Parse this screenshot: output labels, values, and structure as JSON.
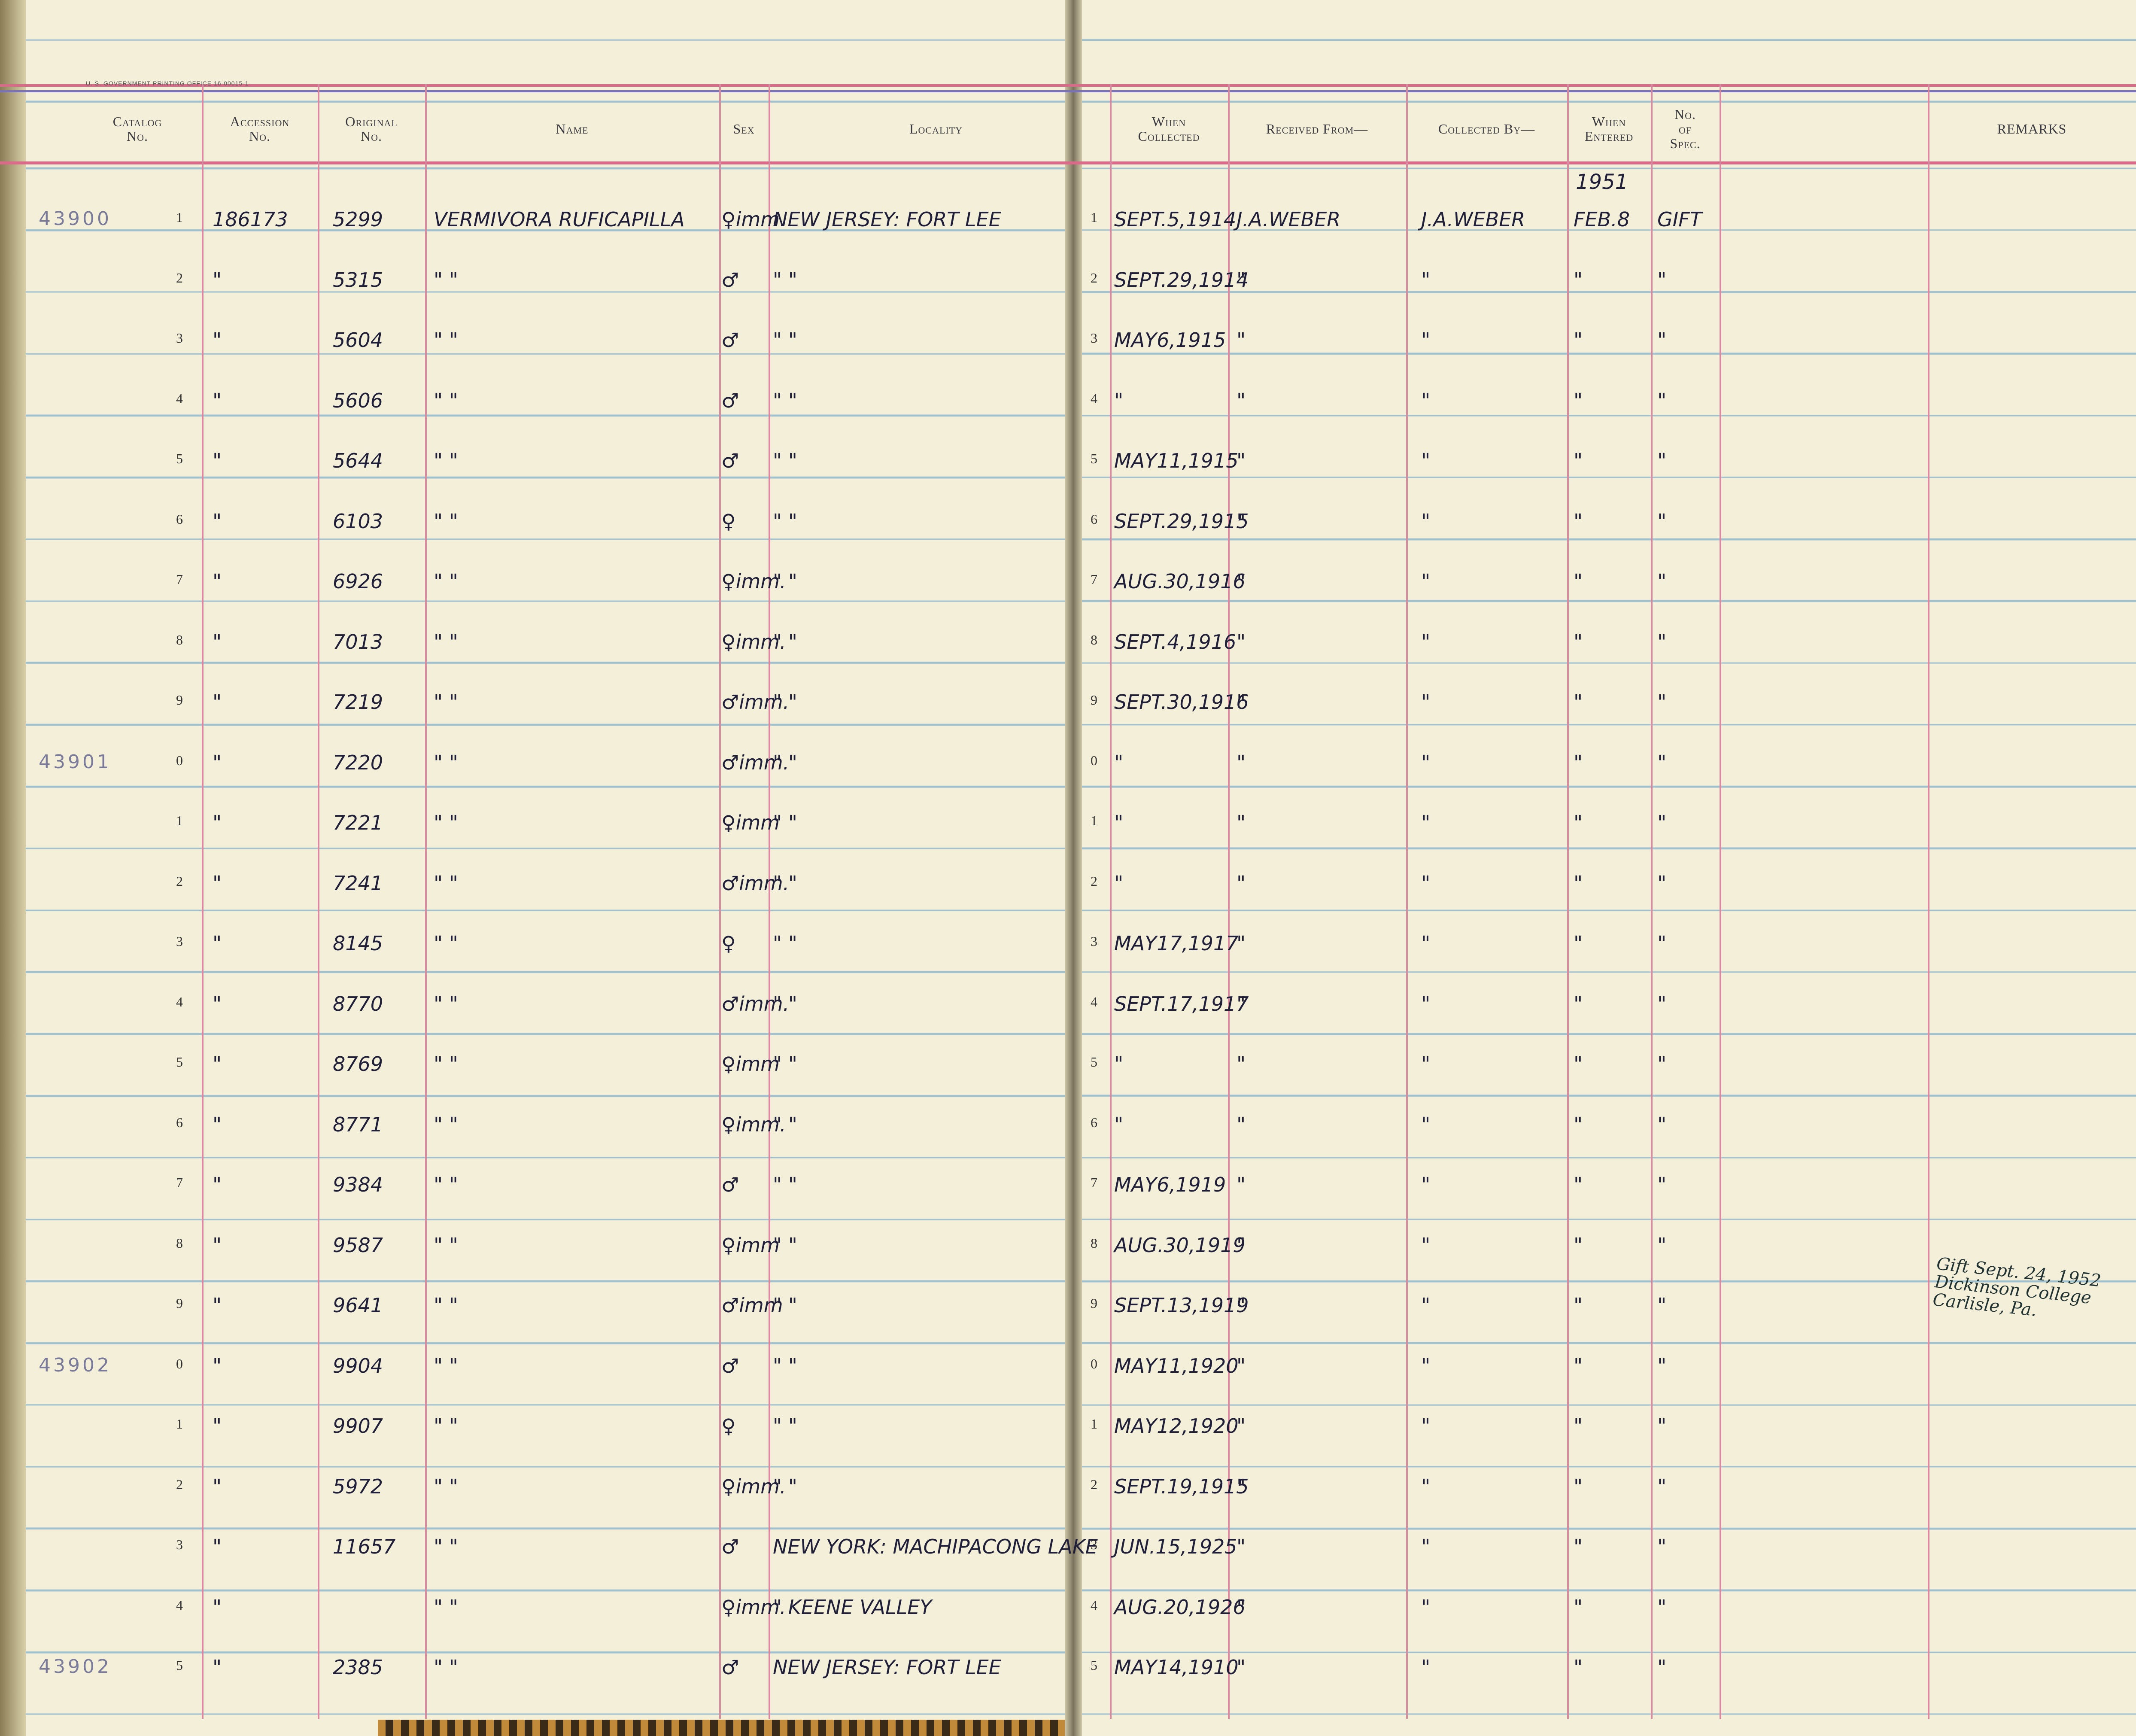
{
  "printer_line": "U. S. GOVERNMENT PRINTING OFFICE   16-00015-1",
  "headers": {
    "catalog": [
      "Catalog",
      "No."
    ],
    "accession": [
      "Accession",
      "No."
    ],
    "original": [
      "Original",
      "No."
    ],
    "name": "Name",
    "sex": "Sex",
    "locality": "Locality",
    "when_collected": [
      "When",
      "Collected"
    ],
    "received_from": "Received From—",
    "collected_by": "Collected By—",
    "when_entered": [
      "When",
      "Entered"
    ],
    "no_of_spec": [
      "No.",
      "of",
      "Spec."
    ],
    "remarks": "REMARKS"
  },
  "year_entered": "1951",
  "rows": [
    {
      "catalog": "43900",
      "idx": "1",
      "accession": "186173",
      "original": "5299",
      "name": "VERMIVORA RUFICAPILLA",
      "sex": "♀imm.",
      "locality": "NEW JERSEY: FORT LEE",
      "ridx": "1",
      "collected": "SEPT.5,1914",
      "received": "J.A.WEBER",
      "collector": "J.A.WEBER",
      "entered": "FEB.8",
      "spec": "GIFT"
    },
    {
      "catalog": "",
      "idx": "2",
      "accession": "\"",
      "original": "5315",
      "name": "\"          \"",
      "sex": "♂",
      "locality": "\"          \"",
      "ridx": "2",
      "collected": "SEPT.29,1914",
      "received": "\"",
      "collector": "\"",
      "entered": "\"",
      "spec": "\""
    },
    {
      "catalog": "",
      "idx": "3",
      "accession": "\"",
      "original": "5604",
      "name": "\"          \"",
      "sex": "♂",
      "locality": "\"          \"",
      "ridx": "3",
      "collected": "MAY6,1915",
      "received": "\"",
      "collector": "\"",
      "entered": "\"",
      "spec": "\""
    },
    {
      "catalog": "",
      "idx": "4",
      "accession": "\"",
      "original": "5606",
      "name": "\"          \"",
      "sex": "♂",
      "locality": "\"          \"",
      "ridx": "4",
      "collected": "\"",
      "received": "\"",
      "collector": "\"",
      "entered": "\"",
      "spec": "\""
    },
    {
      "catalog": "",
      "idx": "5",
      "accession": "\"",
      "original": "5644",
      "name": "\"          \"",
      "sex": "♂",
      "locality": "\"          \"",
      "ridx": "5",
      "collected": "MAY11,1915",
      "received": "\"",
      "collector": "\"",
      "entered": "\"",
      "spec": "\""
    },
    {
      "catalog": "",
      "idx": "6",
      "accession": "\"",
      "original": "6103",
      "name": "\"          \"",
      "sex": "♀",
      "locality": "\"          \"",
      "ridx": "6",
      "collected": "SEPT.29,1915",
      "received": "\"",
      "collector": "\"",
      "entered": "\"",
      "spec": "\""
    },
    {
      "catalog": "",
      "idx": "7",
      "accession": "\"",
      "original": "6926",
      "name": "\"          \"",
      "sex": "♀imm.",
      "locality": "\"          \"",
      "ridx": "7",
      "collected": "AUG.30,1916",
      "received": "\"",
      "collector": "\"",
      "entered": "\"",
      "spec": "\""
    },
    {
      "catalog": "",
      "idx": "8",
      "accession": "\"",
      "original": "7013",
      "name": "\"          \"",
      "sex": "♀imm.",
      "locality": "\"          \"",
      "ridx": "8",
      "collected": "SEPT.4,1916",
      "received": "\"",
      "collector": "\"",
      "entered": "\"",
      "spec": "\""
    },
    {
      "catalog": "",
      "idx": "9",
      "accession": "\"",
      "original": "7219",
      "name": "\"          \"",
      "sex": "♂imm.",
      "locality": "\"          \"",
      "ridx": "9",
      "collected": "SEPT.30,1916",
      "received": "\"",
      "collector": "\"",
      "entered": "\"",
      "spec": "\""
    },
    {
      "catalog": "43901",
      "idx": "0",
      "accession": "\"",
      "original": "7220",
      "name": "\"          \"",
      "sex": "♂imm.",
      "locality": "\"          \"",
      "ridx": "0",
      "collected": "\"",
      "received": "\"",
      "collector": "\"",
      "entered": "\"",
      "spec": "\""
    },
    {
      "catalog": "",
      "idx": "1",
      "accession": "\"",
      "original": "7221",
      "name": "\"          \"",
      "sex": "♀imm",
      "locality": "\"          \"",
      "ridx": "1",
      "collected": "\"",
      "received": "\"",
      "collector": "\"",
      "entered": "\"",
      "spec": "\""
    },
    {
      "catalog": "",
      "idx": "2",
      "accession": "\"",
      "original": "7241",
      "name": "\"          \"",
      "sex": "♂imm.",
      "locality": "\"          \"",
      "ridx": "2",
      "collected": "\"",
      "received": "\"",
      "collector": "\"",
      "entered": "\"",
      "spec": "\""
    },
    {
      "catalog": "",
      "idx": "3",
      "accession": "\"",
      "original": "8145",
      "name": "\"          \"",
      "sex": "♀",
      "locality": "\"          \"",
      "ridx": "3",
      "collected": "MAY17,1917",
      "received": "\"",
      "collector": "\"",
      "entered": "\"",
      "spec": "\""
    },
    {
      "catalog": "",
      "idx": "4",
      "accession": "\"",
      "original": "8770",
      "name": "\"          \"",
      "sex": "♂imm.",
      "locality": "\"          \"",
      "ridx": "4",
      "collected": "SEPT.17,1917",
      "received": "\"",
      "collector": "\"",
      "entered": "\"",
      "spec": "\""
    },
    {
      "catalog": "",
      "idx": "5",
      "accession": "\"",
      "original": "8769",
      "name": "\"          \"",
      "sex": "♀imm",
      "locality": "\"          \"",
      "ridx": "5",
      "collected": "\"",
      "received": "\"",
      "collector": "\"",
      "entered": "\"",
      "spec": "\""
    },
    {
      "catalog": "",
      "idx": "6",
      "accession": "\"",
      "original": "8771",
      "name": "\"          \"",
      "sex": "♀imm.",
      "locality": "\"          \"",
      "ridx": "6",
      "collected": "\"",
      "received": "\"",
      "collector": "\"",
      "entered": "\"",
      "spec": "\""
    },
    {
      "catalog": "",
      "idx": "7",
      "accession": "\"",
      "original": "9384",
      "name": "\"          \"",
      "sex": "♂",
      "locality": "\"          \"",
      "ridx": "7",
      "collected": "MAY6,1919",
      "received": "\"",
      "collector": "\"",
      "entered": "\"",
      "spec": "\""
    },
    {
      "catalog": "",
      "idx": "8",
      "accession": "\"",
      "original": "9587",
      "name": "\"          \"",
      "sex": "♀imm",
      "locality": "\"          \"",
      "ridx": "8",
      "collected": "AUG.30,1919",
      "received": "\"",
      "collector": "\"",
      "entered": "\"",
      "spec": "\""
    },
    {
      "catalog": "",
      "idx": "9",
      "accession": "\"",
      "original": "9641",
      "name": "\"          \"",
      "sex": "♂imm",
      "locality": "\"          \"",
      "ridx": "9",
      "collected": "SEPT.13,1919",
      "received": "\"",
      "collector": "\"",
      "entered": "\"",
      "spec": "\""
    },
    {
      "catalog": "43902",
      "idx": "0",
      "accession": "\"",
      "original": "9904",
      "name": "\"          \"",
      "sex": "♂",
      "locality": "\"          \"",
      "ridx": "0",
      "collected": "MAY11,1920",
      "received": "\"",
      "collector": "\"",
      "entered": "\"",
      "spec": "\""
    },
    {
      "catalog": "",
      "idx": "1",
      "accession": "\"",
      "original": "9907",
      "name": "\"          \"",
      "sex": "♀",
      "locality": "\"          \"",
      "ridx": "1",
      "collected": "MAY12,1920",
      "received": "\"",
      "collector": "\"",
      "entered": "\"",
      "spec": "\""
    },
    {
      "catalog": "",
      "idx": "2",
      "accession": "\"",
      "original": "5972",
      "name": "\"          \"",
      "sex": "♀imm.",
      "locality": "\"          \"",
      "ridx": "2",
      "collected": "SEPT.19,1915",
      "received": "\"",
      "collector": "\"",
      "entered": "\"",
      "spec": "\""
    },
    {
      "catalog": "",
      "idx": "3",
      "accession": "\"",
      "original": "11657",
      "name": "\"          \"",
      "sex": "♂",
      "locality": "NEW YORK: MACHIPACONG LAKE",
      "ridx": "3",
      "collected": "JUN.15,1925",
      "received": "\"",
      "collector": "\"",
      "entered": "\"",
      "spec": "\""
    },
    {
      "catalog": "",
      "idx": "4",
      "accession": "\"",
      "original": "",
      "name": "\"          \"",
      "sex": "♀imm.",
      "locality": "\"   KEENE VALLEY",
      "ridx": "4",
      "collected": "AUG.20,1926",
      "received": "\"",
      "collector": "\"",
      "entered": "\"",
      "spec": "\""
    },
    {
      "catalog": "43902",
      "idx": "5",
      "accession": "\"",
      "original": "2385",
      "name": "\"          \"",
      "sex": "♂",
      "locality": "NEW JERSEY: FORT LEE",
      "ridx": "5",
      "collected": "MAY14,1910",
      "received": "\"",
      "collector": "\"",
      "entered": "\"",
      "spec": "\""
    }
  ],
  "remarks_note": [
    "Gift Sept. 24, 1952",
    "Dickinson College",
    "Carlisle, Pa."
  ]
}
